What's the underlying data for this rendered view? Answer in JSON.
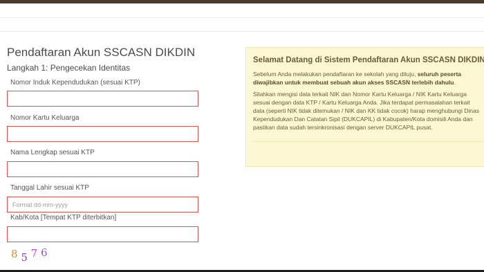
{
  "form": {
    "page_title": "Pendaftaran Akun SSCASN DIKDIN",
    "step_title": "Langkah 1: Pengecekan Identitas",
    "fields": [
      {
        "label": "Nomor Induk Kependudukan (sesuai KTP)",
        "value": "",
        "placeholder": ""
      },
      {
        "label": "Nomor Kartu Keluarga",
        "value": "",
        "placeholder": ""
      },
      {
        "label": "Nama Lengkap sesuai KTP",
        "value": "",
        "placeholder": ""
      },
      {
        "label": "Tanggal Lahir sesuai KTP",
        "value": "",
        "placeholder": "Format dd-mm-yyyy"
      },
      {
        "label": "Kab/Kota [Tempat KTP diterbitkan]",
        "value": "",
        "placeholder": ""
      }
    ],
    "captcha": [
      "8",
      "5",
      "7",
      "6"
    ],
    "captcha_colors": [
      "#e08a1e",
      "#8a3fc9",
      "#c04ad0",
      "#a050d0"
    ],
    "input_border_color": "#d9534f"
  },
  "info": {
    "title": "Selamat Datang di Sistem Pendaftaran Akun SSCASN DIKDIN",
    "p1_prefix": "Sebelum Anda melakukan pendaftaran ke sekolah yang dituju, ",
    "p1_bold": "seluruh peserta diwajibkan untuk membuat sebuah akun akses SSCASN terlebih dahulu",
    "p1_suffix": ".",
    "p2": "Silahkan mengisi data terkait NIK dan Nomor Kartu Keluarga / NIK Kartu Keluarga sesuai dengan data KTP / Kartu Keluarga Anda. Jika terdapat permasalahan terkait data (seperti NIK tidak ditemukan / NIK dan KK tidak cocok) harap menghubungi Dinas Kependudukan Dan Catatan Sipil (DUKCAPIL) di Kabupaten/Kota domisili Anda dan pastikan data sudah tersinkronisasi dengan server DUKCAPIL pusat.",
    "background_color": "#fcf8d4"
  }
}
